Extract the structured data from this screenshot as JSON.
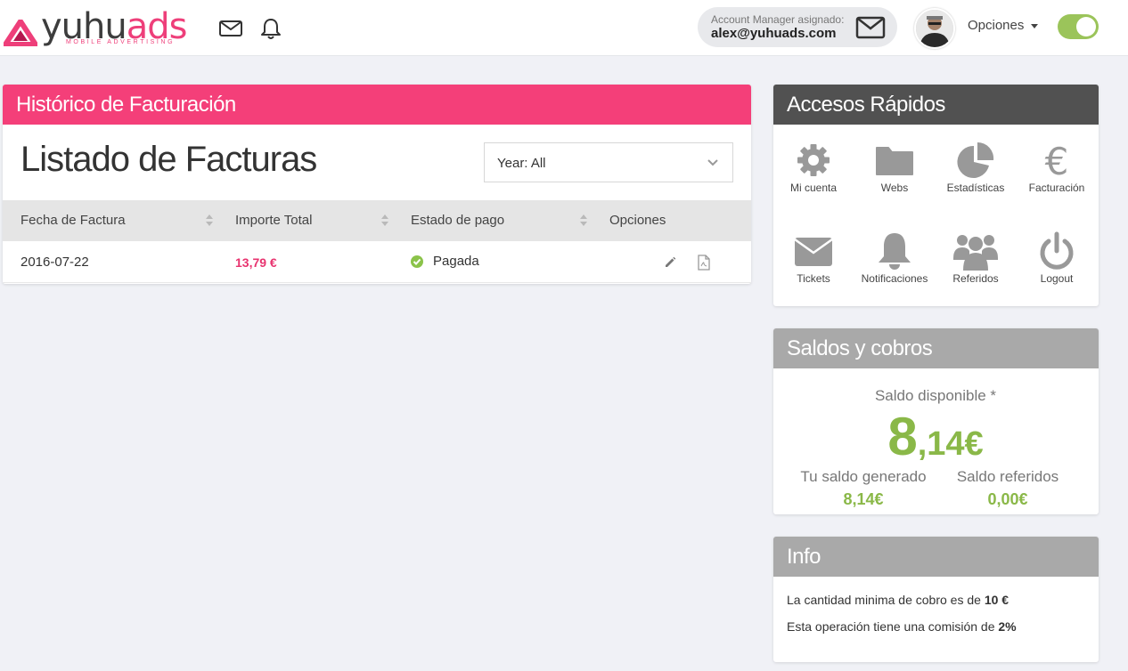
{
  "brand": {
    "name_a": "yuhu",
    "name_b": "ads",
    "tagline": "MOBILE ADVERTISING"
  },
  "header": {
    "account_manager_label": "Account Manager asignado:",
    "account_manager_email": "alex@yuhuads.com",
    "options_label": "Opciones",
    "toggle_on": true,
    "accent_color": "#9bc45a"
  },
  "billing": {
    "panel_title": "Histórico de Facturación",
    "list_title": "Listado de Facturas",
    "year_filter": "Year: All",
    "columns": [
      "Fecha de Factura",
      "Importe Total",
      "Estado de pago",
      "Opciones"
    ],
    "rows": [
      {
        "date": "2016-07-22",
        "amount": "13,79 €",
        "status": "Pagada"
      }
    ],
    "header_color": "#f43f79"
  },
  "quick_access": {
    "title": "Accesos Rápidos",
    "items": [
      {
        "label": "Mi cuenta",
        "icon": "gear-icon"
      },
      {
        "label": "Webs",
        "icon": "folder-icon"
      },
      {
        "label": "Estadísticas",
        "icon": "pie-chart-icon"
      },
      {
        "label": "Facturación",
        "icon": "euro-icon"
      },
      {
        "label": "Tickets",
        "icon": "envelope-icon"
      },
      {
        "label": "Notificaciones",
        "icon": "bell-icon"
      },
      {
        "label": "Referidos",
        "icon": "users-icon"
      },
      {
        "label": "Logout",
        "icon": "power-icon"
      }
    ]
  },
  "balance": {
    "title": "Saldos y cobros",
    "available_label": "Saldo disponible *",
    "available_int": "8",
    "available_dec": ",14€",
    "generated_label": "Tu saldo generado",
    "generated_value": "8,14€",
    "referrals_label": "Saldo referidos",
    "referrals_value": "0,00€",
    "value_color": "#8ab848"
  },
  "info": {
    "title": "Info",
    "line1_text": "La cantidad minima de cobro es de ",
    "line1_bold": "10 €",
    "line2_text": "Esta operación tiene una comisión de ",
    "line2_bold": "2%"
  }
}
